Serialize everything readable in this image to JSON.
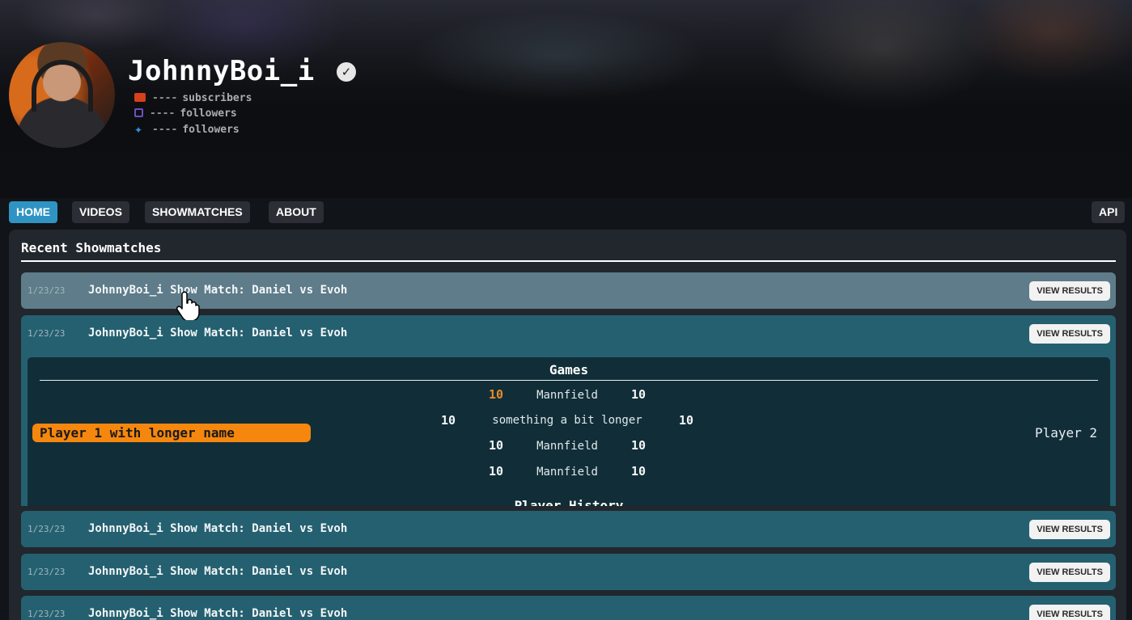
{
  "channel": {
    "name": "JohnnyBoi_i",
    "stats": [
      {
        "icon": "youtube-icon",
        "count": "----",
        "label": "subscribers"
      },
      {
        "icon": "twitch-icon",
        "count": "----",
        "label": "followers"
      },
      {
        "icon": "twitter-icon",
        "count": "----",
        "label": "followers"
      }
    ]
  },
  "nav": {
    "tabs": [
      {
        "label": "HOME",
        "active": true
      },
      {
        "label": "VIDEOS",
        "active": false
      },
      {
        "label": "SHOWMATCHES",
        "active": false
      },
      {
        "label": "ABOUT",
        "active": false
      }
    ],
    "api_label": "API"
  },
  "section": {
    "title": "Recent Showmatches"
  },
  "matches": [
    {
      "date": "1/23/23",
      "title": "JohnnyBoi_i Show Match: Daniel vs Evoh",
      "button": "VIEW RESULTS"
    },
    {
      "date": "1/23/23",
      "title": "JohnnyBoi_i Show Match: Daniel vs Evoh",
      "button": "VIEW RESULTS"
    },
    {
      "date": "1/23/23",
      "title": "JohnnyBoi_i Show Match: Daniel vs Evoh",
      "button": "VIEW RESULTS"
    },
    {
      "date": "1/23/23",
      "title": "JohnnyBoi_i Show Match: Daniel vs Evoh",
      "button": "VIEW RESULTS"
    },
    {
      "date": "1/23/23",
      "title": "JohnnyBoi_i Show Match: Daniel vs Evoh",
      "button": "VIEW RESULTS"
    }
  ],
  "results": {
    "games_title": "Games",
    "player1": "Player 1 with longer name",
    "player2": "Player 2",
    "series_score": {
      "player1": "10",
      "player2": "10"
    },
    "games": [
      {
        "p1": "10",
        "map": "Mannfield",
        "p2": "10",
        "p1_win": true
      },
      {
        "p1": "10",
        "map": "something a bit longer",
        "p2": "10",
        "p1_win": false
      },
      {
        "p1": "10",
        "map": "Mannfield",
        "p2": "10",
        "p1_win": false
      },
      {
        "p1": "10",
        "map": "Mannfield",
        "p2": "10",
        "p1_win": false
      }
    ],
    "history_title": "Player History"
  },
  "colors": {
    "accent_blue": "#2f94c3",
    "row_teal": "#256070",
    "row_hover": "#5e7c89",
    "player1_orange": "#f5870e",
    "win_orange": "#e88b2a"
  }
}
